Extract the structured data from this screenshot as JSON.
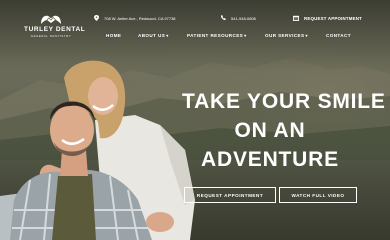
{
  "brand": {
    "name": "TURLEY DENTAL",
    "tagline": "GENERAL DENTISTRY"
  },
  "contact": {
    "address": "708 W. Antler Ave., Redwood, CA 97738",
    "phone": "541-948-0806",
    "appointment": "REQUEST APPOINTMENT"
  },
  "nav": {
    "items": [
      {
        "label": "HOME",
        "dropdown": false
      },
      {
        "label": "ABOUT US",
        "dropdown": true
      },
      {
        "label": "PATIENT RESOURCES",
        "dropdown": true
      },
      {
        "label": "OUR SERVICES",
        "dropdown": true
      },
      {
        "label": "CONTACT",
        "dropdown": false
      }
    ]
  },
  "hero": {
    "headline_lines": [
      "TAKE YOUR SMILE",
      "ON AN",
      "ADVENTURE"
    ],
    "request_button": "REQUEST APPOINTMENT",
    "video_button": "WATCH FULL VIDEO"
  },
  "icons": {
    "logo": "tooth-mountain-logo",
    "address": "map-pin-icon",
    "phone": "phone-icon",
    "appointment": "calendar-icon",
    "dropdown": "chevron-down-icon"
  },
  "colors": {
    "text": "#ffffff"
  }
}
